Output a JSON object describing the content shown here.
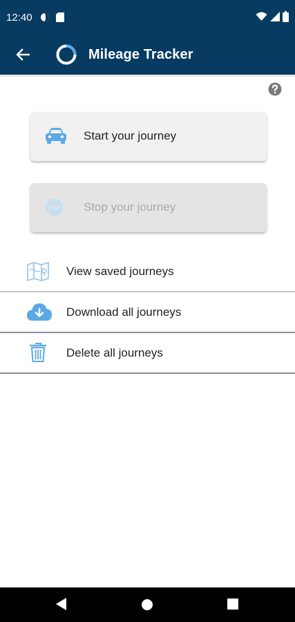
{
  "status_bar": {
    "time": "12:40",
    "icons": [
      "data-saver-icon",
      "sim-card-icon",
      "wifi-icon",
      "signal-icon",
      "battery-icon"
    ]
  },
  "app_bar": {
    "title": "Mileage Tracker",
    "back_icon": "arrow-left-icon",
    "logo_icon": "ring-logo-icon",
    "color": "#073b62"
  },
  "help": {
    "icon": "question-circle-icon"
  },
  "actions": [
    {
      "label": "Start your journey",
      "icon": "car-icon",
      "enabled": true
    },
    {
      "label": "Stop your journey",
      "icon": "stop-sign-icon",
      "enabled": false
    }
  ],
  "menu": [
    {
      "label": "View saved journeys",
      "icon": "map-icon"
    },
    {
      "label": "Download all journeys",
      "icon": "cloud-download-icon"
    },
    {
      "label": "Delete all journeys",
      "icon": "trash-icon"
    }
  ],
  "nav": {
    "icons": [
      "back-triangle-icon",
      "home-circle-icon",
      "recents-square-icon"
    ]
  },
  "colors": {
    "accent": "#5aa9e6",
    "header": "#073b62",
    "disabled_text": "#a9a9a9"
  }
}
